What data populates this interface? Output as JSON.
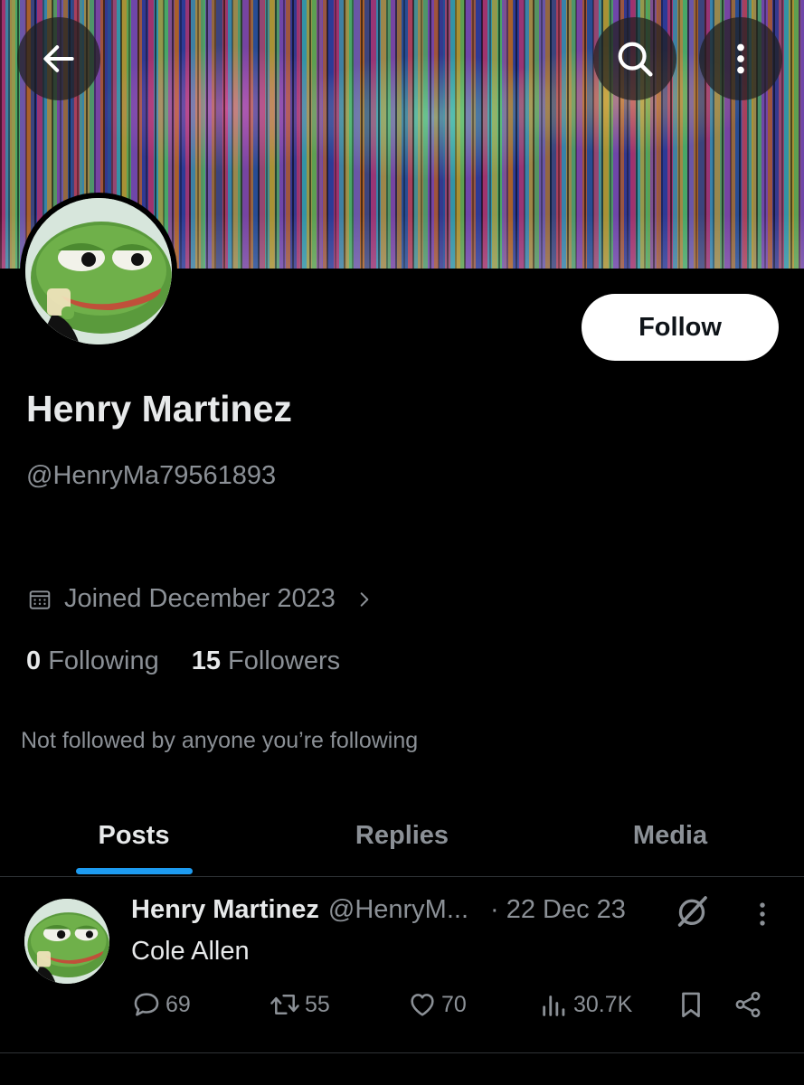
{
  "header": {
    "back_icon": "arrow-left-icon",
    "search_icon": "search-icon",
    "more_icon": "more-vertical-icon"
  },
  "profile": {
    "name": "Henry Martinez",
    "handle": "@HenryMa79561893",
    "follow_label": "Follow",
    "joined": "Joined December 2023",
    "following_count": "0",
    "following_label": "Following",
    "followers_count": "15",
    "followers_label": "Followers",
    "not_followed_text": "Not followed by anyone you’re following"
  },
  "tabs": [
    {
      "label": "Posts",
      "active": true
    },
    {
      "label": "Replies",
      "active": false
    },
    {
      "label": "Media",
      "active": false
    }
  ],
  "post": {
    "author": "Henry Martinez",
    "handle": "@HenryM...",
    "date": "· 22 Dec 23",
    "text": "Cole Allen",
    "replies": "69",
    "reposts": "55",
    "likes": "70",
    "views": "30.7K"
  },
  "colors": {
    "background": "#000000",
    "text_primary": "#e7e9ea",
    "text_secondary": "#8b9096",
    "accent": "#1d9bf0",
    "follow_button_bg": "#ffffff"
  }
}
